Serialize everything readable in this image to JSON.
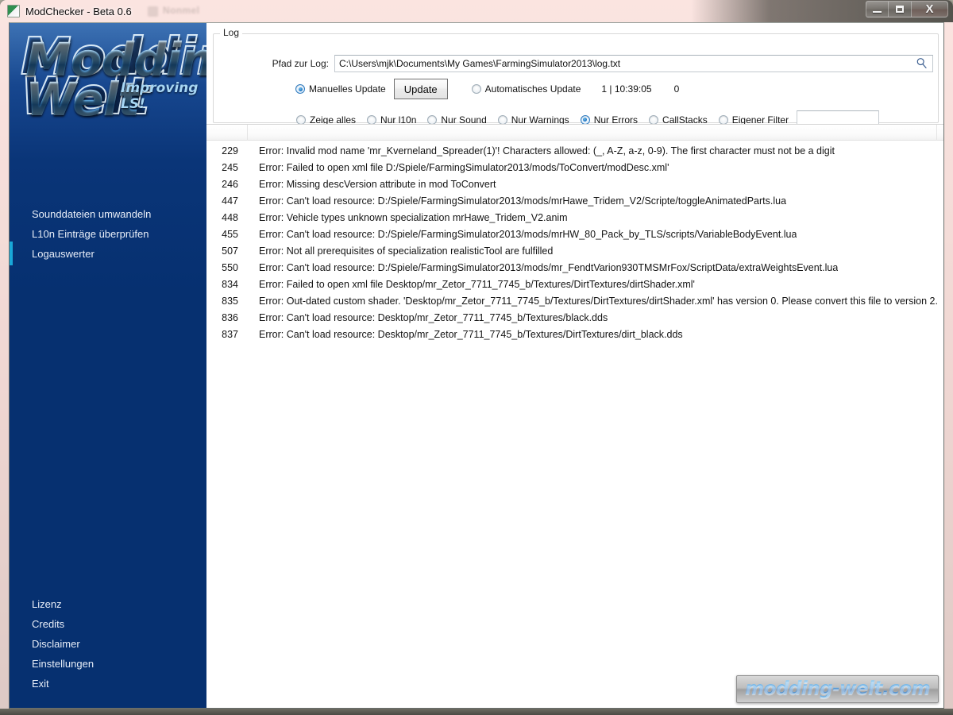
{
  "window": {
    "title": "ModChecker - Beta 0.6",
    "icon": "app-icon",
    "ghost_title": "Nonmel",
    "controls": {
      "minimize": "minimize-icon",
      "maximize": "maximize-icon",
      "close": "X"
    }
  },
  "sidebar": {
    "logo": {
      "line1": "Modding",
      "line2": "Welt",
      "tagline": "Improving LS!"
    },
    "top_items": [
      {
        "label": "Sounddateien umwandeln"
      },
      {
        "label": "L10n Einträge überprüfen"
      },
      {
        "label": "Logauswerter"
      }
    ],
    "bottom_items": [
      {
        "label": "Lizenz"
      },
      {
        "label": "Credits"
      },
      {
        "label": "Disclaimer"
      },
      {
        "label": "Einstellungen"
      },
      {
        "label": "Exit"
      }
    ]
  },
  "log_group": {
    "legend": "Log",
    "path_label": "Pfad zur Log:",
    "path_value": "C:\\Users\\mjk\\Documents\\My Games\\FarmingSimulator2013\\log.txt",
    "path_placeholder": "",
    "search_icon": "search-icon",
    "update_mode": [
      {
        "label": "Manuelles Update",
        "checked": true
      },
      {
        "label": "Automatisches Update",
        "checked": false
      }
    ],
    "update_button": "Update",
    "status_counter": "1 | 10:39:05",
    "status_extra": "0",
    "filters": [
      {
        "label": "Zeige alles",
        "checked": false
      },
      {
        "label": "Nur l10n",
        "checked": false
      },
      {
        "label": "Nur Sound",
        "checked": false
      },
      {
        "label": "Nur Warnings",
        "checked": false
      },
      {
        "label": "Nur Errors",
        "checked": true
      },
      {
        "label": "CallStacks",
        "checked": false
      },
      {
        "label": "Eigener Filter",
        "checked": false
      }
    ],
    "custom_filter_value": "",
    "custom_filter_placeholder": ""
  },
  "list": {
    "columns": [
      "",
      "",
      ""
    ],
    "rows": [
      {
        "line": "229",
        "message": "Error: Invalid mod name 'mr_Kverneland_Spreader(1)'! Characters allowed: (_, A-Z, a-z, 0-9). The first character must not be a digit"
      },
      {
        "line": "245",
        "message": "Error: Failed to open xml file D:/Spiele/FarmingSimulator2013/mods/ToConvert/modDesc.xml'"
      },
      {
        "line": "246",
        "message": "Error: Missing descVersion attribute in mod ToConvert"
      },
      {
        "line": "447",
        "message": "Error: Can't load resource: D:/Spiele/FarmingSimulator2013/mods/mrHawe_Tridem_V2/Scripte/toggleAnimatedParts.lua"
      },
      {
        "line": "448",
        "message": "Error: Vehicle types unknown specialization mrHawe_Tridem_V2.anim"
      },
      {
        "line": "455",
        "message": "Error: Can't load resource: D:/Spiele/FarmingSimulator2013/mods/mrHW_80_Pack_by_TLS/scripts/VariableBodyEvent.lua"
      },
      {
        "line": "507",
        "message": "Error: Not all prerequisites of specialization realisticTool are fulfilled"
      },
      {
        "line": "550",
        "message": "Error: Can't load resource: D:/Spiele/FarmingSimulator2013/mods/mr_FendtVarion930TMSMrFox/ScriptData/extraWeightsEvent.lua"
      },
      {
        "line": "834",
        "message": "Error: Failed to open xml file Desktop/mr_Zetor_7711_7745_b/Textures/DirtTextures/dirtShader.xml'"
      },
      {
        "line": "835",
        "message": "Error: Out-dated custom shader. 'Desktop/mr_Zetor_7711_7745_b/Textures/DirtTextures/dirtShader.xml' has version 0. Please convert this file to version 2."
      },
      {
        "line": "836",
        "message": "Error: Can't load resource: Desktop/mr_Zetor_7711_7745_b/Textures/black.dds"
      },
      {
        "line": "837",
        "message": "Error: Can't load resource: Desktop/mr_Zetor_7711_7745_b/Textures/DirtTextures/dirt_black.dds"
      }
    ]
  },
  "watermark": {
    "text": "modding-welt.com"
  },
  "colors": {
    "sidebar_blue": "#063070",
    "sidebar_top_blue": "#3d72b4",
    "accent_cyan": "#19a8d8",
    "radio_selected": "#1b6fbd",
    "watermark_blue": "#3f93d8"
  }
}
